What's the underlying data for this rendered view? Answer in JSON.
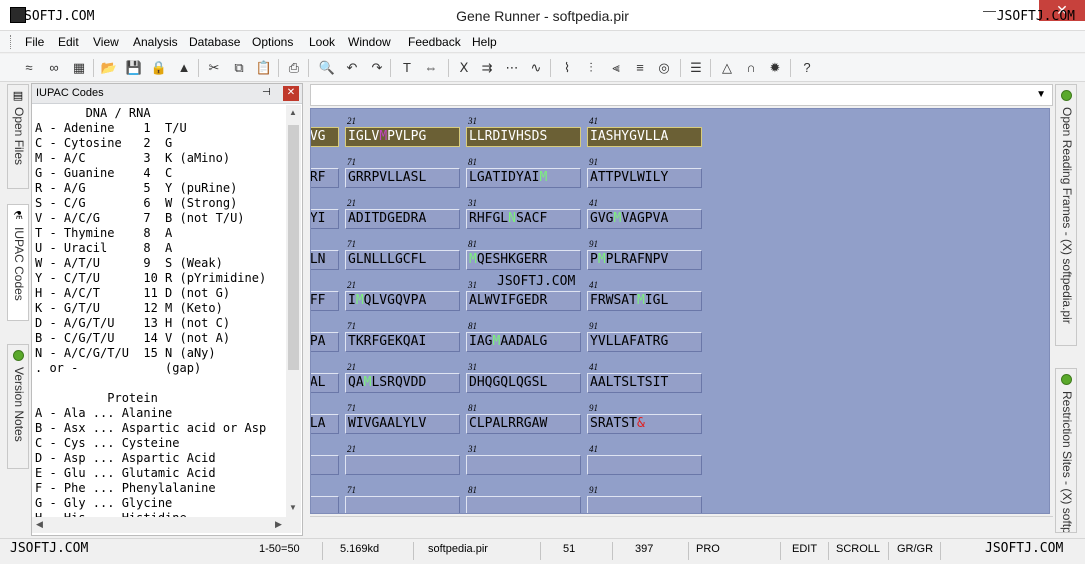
{
  "titlebar": {
    "title": "Gene Runner - softpedia.pir",
    "watermark_left": "SOFTJ.COM",
    "watermark_right": "JSOFTJ.COM",
    "close": "✕",
    "minimize": "—"
  },
  "menu": [
    "File",
    "Edit",
    "View",
    "Analysis",
    "Database",
    "Options",
    "Look",
    "Window",
    "Feedback",
    "Help"
  ],
  "toolbar": [
    {
      "icon": "dna-icon",
      "glyph": "≈"
    },
    {
      "icon": "dna2-icon",
      "glyph": "∞"
    },
    {
      "icon": "grid-icon",
      "glyph": "▦"
    },
    {
      "icon": "open-folder-icon",
      "glyph": "📂"
    },
    {
      "icon": "save-icon",
      "glyph": "💾"
    },
    {
      "icon": "lock-icon",
      "glyph": "🔒"
    },
    {
      "icon": "stack-icon",
      "glyph": "▲"
    },
    {
      "icon": "cut-icon",
      "glyph": "✂"
    },
    {
      "icon": "copy-icon",
      "glyph": "⧉"
    },
    {
      "icon": "paste-icon",
      "glyph": "📋"
    },
    {
      "icon": "print-icon",
      "glyph": "⎙"
    },
    {
      "icon": "find-icon",
      "glyph": "🔍"
    },
    {
      "icon": "undo-icon",
      "glyph": "↶"
    },
    {
      "icon": "redo-icon",
      "glyph": "↷"
    },
    {
      "icon": "text-icon",
      "glyph": "T"
    },
    {
      "icon": "translate-icon",
      "glyph": "⇔"
    },
    {
      "icon": "primer-icon",
      "glyph": "ⵝ"
    },
    {
      "icon": "align-icon",
      "glyph": "⇉"
    },
    {
      "icon": "dots-icon",
      "glyph": "⋯"
    },
    {
      "icon": "wave-icon",
      "glyph": "∿"
    },
    {
      "icon": "restriction-icon",
      "glyph": "⌇"
    },
    {
      "icon": "ladder-icon",
      "glyph": "⫶"
    },
    {
      "icon": "digest-icon",
      "glyph": "⫷"
    },
    {
      "icon": "merge-icon",
      "glyph": "≡"
    },
    {
      "icon": "circular-icon",
      "glyph": "◎"
    },
    {
      "icon": "list-icon",
      "glyph": "☰"
    },
    {
      "icon": "triangle-icon",
      "glyph": "△"
    },
    {
      "icon": "arch-icon",
      "glyph": "∩"
    },
    {
      "icon": "sun-icon",
      "glyph": "✹"
    },
    {
      "icon": "help-icon",
      "glyph": "?"
    }
  ],
  "left_tabs": [
    "Open Files",
    "IUPAC Codes",
    "Version Notes"
  ],
  "right_tabs": [
    "Open Reading Frames - (X) softpedia.pir",
    "Restriction Sites - (X) softpedia.pir"
  ],
  "iupac": {
    "title": "IUPAC Codes",
    "pin": "⊣",
    "close": "✕",
    "lines": [
      "       DNA / RNA",
      "A - Adenine    1  T/U",
      "C - Cytosine   2  G",
      "M - A/C        3  K (aMino)",
      "G - Guanine    4  C",
      "R - A/G        5  Y (puRine)",
      "S - C/G        6  W (Strong)",
      "V - A/C/G      7  B (not T/U)",
      "T - Thymine    8  A",
      "U - Uracil     8  A",
      "W - A/T/U      9  S (Weak)",
      "Y - C/T/U      10 R (pYrimidine)",
      "H - A/C/T      11 D (not G)",
      "K - G/T/U      12 M (Keto)",
      "D - A/G/T/U    13 H (not C)",
      "B - C/G/T/U    14 V (not A)",
      "N - A/C/G/T/U  15 N (aNy)",
      ". or -            (gap)",
      "",
      "          Protein",
      "A - Ala ... Alanine",
      "B - Asx ... Aspartic acid or Asp",
      "C - Cys ... Cysteine",
      "D - Asp ... Aspartic Acid",
      "E - Glu ... Glutamic Acid",
      "F - Phe ... Phenylalanine",
      "G - Gly ... Glycine",
      "H - His ... Histidine"
    ]
  },
  "sequence": {
    "watermark": "JSOFTJ.COM",
    "rows": [
      {
        "indices": [
          "21",
          "31",
          "41"
        ],
        "cells": [
          [
            "AVG"
          ],
          [
            "IGLV",
            "*M",
            "PVLPG"
          ],
          [
            "LLRDIVHSDS"
          ],
          [
            "IASHYGVLLA"
          ]
        ],
        "selected": true
      },
      {
        "indices": [
          "71",
          "81",
          "91"
        ],
        "cells": [
          [
            "ORF"
          ],
          [
            "GRRPVLLASL"
          ],
          [
            "LGATIDYAI",
            "+M"
          ],
          [
            "ATTPVLWILY"
          ]
        ]
      },
      {
        "indices": [
          "21",
          "31",
          "41"
        ],
        "cells": [
          [
            "AYI"
          ],
          [
            "ADITDGEDRA"
          ],
          [
            "RHFGL",
            "+N",
            "SACF"
          ],
          [
            "GVG",
            "+M",
            "VAGPVA"
          ]
        ]
      },
      {
        "indices": [
          "71",
          "81",
          "91"
        ],
        "cells": [
          [
            "VLN"
          ],
          [
            "GLNLLLGCFL"
          ],
          [
            "+M",
            "QESHKGERR"
          ],
          [
            "P",
            "+M",
            "PLRAFNPV"
          ]
        ]
      },
      {
        "indices": [
          "21",
          "31",
          "41"
        ],
        "cells": [
          [
            "VFF"
          ],
          [
            "I",
            "+M",
            "QLVGQVPA"
          ],
          [
            "ALWVIFGEDR"
          ],
          [
            "FRWSAT",
            "+M",
            "IGL"
          ]
        ]
      },
      {
        "indices": [
          "71",
          "81",
          "91"
        ],
        "cells": [
          [
            "GPA"
          ],
          [
            "TKRFGEKQAI"
          ],
          [
            "IAG",
            "+M",
            "AADALG"
          ],
          [
            "YVLLAFATRG"
          ]
        ]
      },
      {
        "indices": [
          "21",
          "31",
          "41"
        ],
        "cells": [
          [
            "PAL"
          ],
          [
            "QA",
            "+M",
            "LSRQVDD"
          ],
          [
            "DHQGQLQGSL"
          ],
          [
            "AALTSLTSIT"
          ]
        ]
      },
      {
        "indices": [
          "71",
          "81",
          "91"
        ],
        "cells": [
          [
            "GLA"
          ],
          [
            "WIVGAALYLV"
          ],
          [
            "CLPALRRGAW"
          ],
          [
            "SRATST",
            "!&"
          ]
        ]
      },
      {
        "indices": [
          "21",
          "31",
          "41"
        ],
        "cells": [
          [
            ""
          ],
          [
            ""
          ],
          [
            ""
          ],
          [
            ""
          ]
        ]
      },
      {
        "indices": [
          "71",
          "81",
          "91"
        ],
        "cells": [
          [
            ""
          ],
          [
            ""
          ],
          [
            ""
          ],
          [
            ""
          ]
        ]
      }
    ]
  },
  "status": {
    "watermark_left": "JSOFTJ.COM",
    "range": "1-50=50",
    "mw": "5.169kd",
    "file": "softpedia.pir",
    "n1": "51",
    "n2": "397",
    "type": "PRO",
    "mode": "EDIT",
    "scroll": "SCROLL",
    "gr": "GR/GR",
    "watermark_right": "JSOFTJ.COM"
  },
  "colors": {
    "sequence_bg": "#919fc9",
    "selected_cell": "#6b6035",
    "highlight_green": "#7cf07c",
    "close_red": "#c7413c"
  }
}
